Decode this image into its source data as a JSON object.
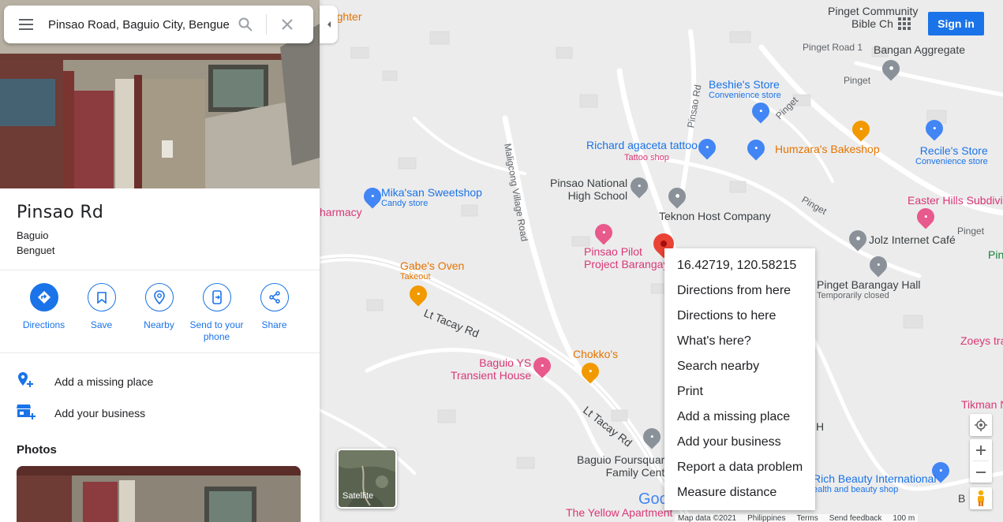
{
  "search": {
    "value": "Pinsao Road, Baguio City, Benguet",
    "menu_icon": "menu-icon",
    "search_icon": "search-icon",
    "clear_icon": "close-icon"
  },
  "place": {
    "name": "Pinsao Rd",
    "line1": "Baguio",
    "line2": "Benguet"
  },
  "actions": [
    {
      "label": "Directions",
      "icon": "directions-icon"
    },
    {
      "label": "Save",
      "icon": "bookmark-icon"
    },
    {
      "label": "Nearby",
      "icon": "nearby-icon"
    },
    {
      "label": "Send to your phone",
      "icon": "send-to-phone-icon"
    },
    {
      "label": "Share",
      "icon": "share-icon"
    }
  ],
  "list": [
    {
      "label": "Add a missing place",
      "icon": "add-place-icon"
    },
    {
      "label": "Add your business",
      "icon": "add-business-icon"
    }
  ],
  "photos_heading": "Photos",
  "header": {
    "signin": "Sign in"
  },
  "map_labels": {
    "laughter": "aughter",
    "pinget_community": "Pinget Community",
    "bible_church": "Bible Ch",
    "pinget_road_1": "Pinget Road 1",
    "bangan": "Bangan Aggregate",
    "pinget_a": "Pinget",
    "beshie": "Beshie's Store",
    "beshie_sub": "Convenience store",
    "pinsao_rd": "Pinsao Rd",
    "pinget_b": "Pinget",
    "richard": "Richard agaceta tattoo",
    "richard_sub": "Tattoo shop",
    "humzara": "Humzara's Bakeshop",
    "recile": "Recile's Store",
    "recile_sub": "Convenience store",
    "maligcong": "Maligcong Village Road",
    "pinsao_hs_1": "Pinsao National",
    "pinsao_hs_2": "High School",
    "pinget_c": "Pinget",
    "easter": "Easter Hills Subdivi",
    "mikasan": "Mika'san Sweetshop",
    "mikasan_sub": "Candy store",
    "teknon": "Teknon Host Company",
    "pinget_d": "Pinget",
    "pharmacy": "harmacy",
    "jolz": "Jolz Internet Café",
    "pin_edge": "Pin",
    "pinsao_pilot_1": "Pinsao Pilot",
    "pinsao_pilot_2": "Project Barangay",
    "gabe": "Gabe's Oven",
    "gabe_sub": "Takeout",
    "pinget_brgy": "Pinget Barangay Hall",
    "pinget_brgy_sub": "Temporarily closed",
    "lt_tacay_a": "Lt Tacay Rd",
    "zoeys": "Zoeys trans",
    "baguio_ys_1": "Baguio YS",
    "baguio_ys_2": "Transient House",
    "chokko": "Chokko's",
    "lt_tacay_b": "Lt Tacay Rd",
    "tikman": "Tikman N",
    "h_letter": "H",
    "foursquare_1": "Baguio Foursquare",
    "foursquare_2": "Family Cente",
    "rich_beauty": "Rich Beauty International",
    "rich_beauty_sub": "ealth and beauty shop",
    "b_letter": "B",
    "yellow_apt": "The Yellow Apartment",
    "goo": "Goo"
  },
  "satellite_label": "Satellite",
  "context_menu": [
    "16.42719, 120.58215",
    "Directions from here",
    "Directions to here",
    "What's here?",
    "Search nearby",
    "Print",
    "Add a missing place",
    "Add your business",
    "Report a data problem",
    "Measure distance"
  ],
  "footer": {
    "map_data": "Map data ©2021",
    "country": "Philippines",
    "terms": "Terms",
    "feedback": "Send feedback",
    "scale": "100 m"
  },
  "colors": {
    "accent": "#1a73e8",
    "marker": "#ea4335",
    "poi_orange": "#e37400",
    "poi_pink": "#d93775"
  }
}
